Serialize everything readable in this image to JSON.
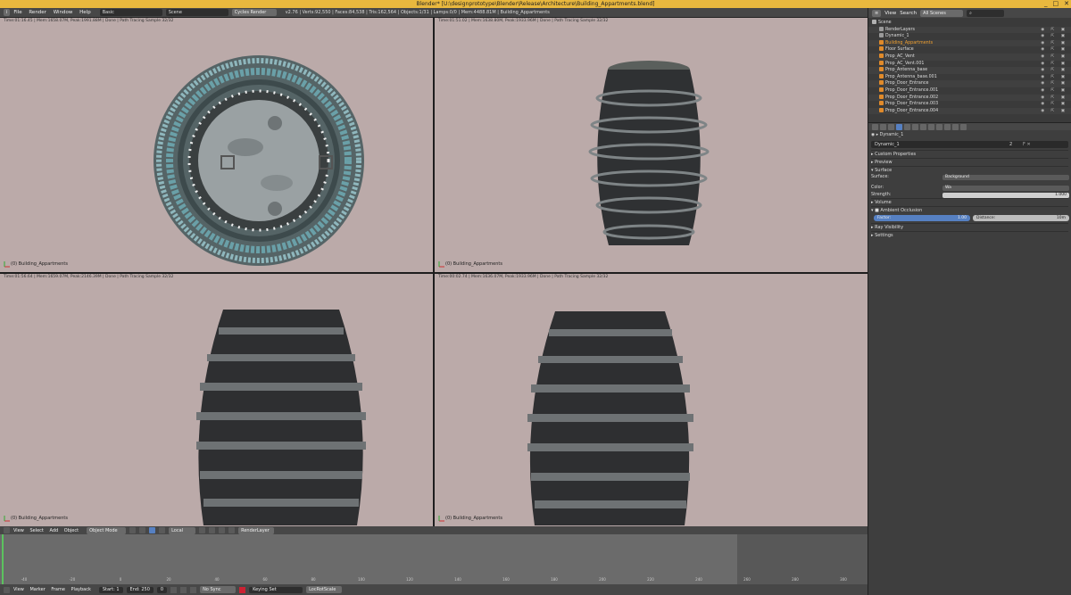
{
  "window": {
    "title": "Blender* [U:\\designprototype\\Blender\\Release\\Architecture\\Building_Appartments.blend]",
    "controls": [
      "_",
      "□",
      "✕"
    ]
  },
  "topbar": {
    "menu": [
      "File",
      "Render",
      "Window",
      "Help"
    ],
    "screen": "Basic",
    "scene": "Scene",
    "engine": "Cycles Render",
    "stats": "v2.76 | Verts:92,550 | Faces:84,538 | Tris:162,564 | Objects:1/31 | Lamps:0/0 | Mem:4488.81M | Building_Appartments"
  },
  "viewports": [
    {
      "status": "Time:01:16.45 | Mem:1658.07M, Peak:1991.88M | Done | Path Tracing Sample 32/32",
      "label": "(0) Building_Appartments"
    },
    {
      "status": "Time:01:51.02 | Mem:1638.80M, Peak:1933.96M | Done | Path Tracing Sample 32/32",
      "label": "(0) Building_Appartments"
    },
    {
      "status": "Time:01:56.64 | Mem:1659.07M, Peak:2146.39M | Done | Path Tracing Sample 32/32",
      "label": "(0) Building_Appartments"
    },
    {
      "status": "Time:00:02.74 | Mem:1636.07M, Peak:1933.96M | Done | Path Tracing Sample 32/32",
      "label": "(0) Building_Appartments"
    }
  ],
  "viewheader": {
    "menu": [
      "View",
      "Select",
      "Add",
      "Object"
    ],
    "mode": "Object Mode",
    "pivot": "Local",
    "layer": "RenderLayer"
  },
  "timeline": {
    "ticks": [
      "-40",
      "-20",
      "0",
      "20",
      "40",
      "60",
      "80",
      "100",
      "120",
      "140",
      "160",
      "180",
      "200",
      "220",
      "240",
      "260",
      "280",
      "300"
    ],
    "menu": [
      "View",
      "Marker",
      "Frame",
      "Playback"
    ],
    "start_label": "Start:",
    "start": "1",
    "end_label": "End:",
    "end": "250",
    "current": "0",
    "sync": "No Sync",
    "keying": "Keying Set",
    "shuffle": "LocRotScale"
  },
  "outliner": {
    "menu": [
      "View",
      "Search"
    ],
    "filter": "All Scenes",
    "items": [
      {
        "label": "Scene",
        "color": "#b0b0b0",
        "indent": 0,
        "selected": false
      },
      {
        "label": "RenderLayers",
        "color": "#9a9a9a",
        "indent": 1,
        "selected": false
      },
      {
        "label": "Dynamic_1",
        "color": "#9a9a9a",
        "indent": 1,
        "selected": false
      },
      {
        "label": "Building_Appartments",
        "color": "#e08a2a",
        "indent": 1,
        "selected": true
      },
      {
        "label": "Floor Surface",
        "color": "#e08a2a",
        "indent": 1,
        "selected": false
      },
      {
        "label": "Prop_AC_Vent",
        "color": "#e08a2a",
        "indent": 1,
        "selected": false
      },
      {
        "label": "Prop_AC_Vent.001",
        "color": "#e08a2a",
        "indent": 1,
        "selected": false
      },
      {
        "label": "Prop_Antenna_base",
        "color": "#e08a2a",
        "indent": 1,
        "selected": false
      },
      {
        "label": "Prop_Antenna_base.001",
        "color": "#e08a2a",
        "indent": 1,
        "selected": false
      },
      {
        "label": "Prop_Door_Entrance",
        "color": "#e08a2a",
        "indent": 1,
        "selected": false
      },
      {
        "label": "Prop_Door_Entrance.001",
        "color": "#e08a2a",
        "indent": 1,
        "selected": false
      },
      {
        "label": "Prop_Door_Entrance.002",
        "color": "#e08a2a",
        "indent": 1,
        "selected": false
      },
      {
        "label": "Prop_Door_Entrance.003",
        "color": "#e08a2a",
        "indent": 1,
        "selected": false
      },
      {
        "label": "Prop_Door_Entrance.004",
        "color": "#e08a2a",
        "indent": 1,
        "selected": false
      }
    ]
  },
  "properties": {
    "breadcrumb": "Dynamic_1",
    "world_name": "Dynamic_1",
    "users": "2",
    "sections_top": [
      "Custom Properties",
      "Preview",
      "Surface"
    ],
    "surface_label": "Surface:",
    "surface_value": "Background",
    "color_label": "Color:",
    "color_value": "Wa",
    "strength_label": "Strength:",
    "strength_value": "1.000",
    "volume": "Volume",
    "ao": "Ambient Occlusion",
    "factor_label": "Factor:",
    "factor_value": "1.00",
    "distance_label": "Distance:",
    "distance_value": "10m",
    "sections_bottom": [
      "Ray Visibility",
      "Settings"
    ]
  },
  "colors": {
    "viewport_bg": "#bbaaa9",
    "accent": "#5680c2",
    "title_bg": "#e9b83e"
  }
}
